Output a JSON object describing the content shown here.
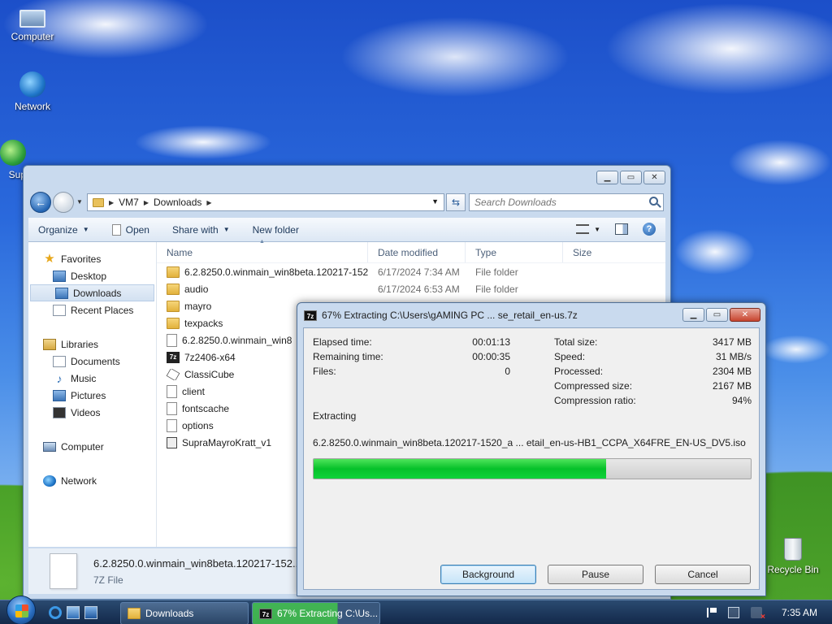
{
  "desktop": {
    "icons": [
      {
        "label": "Computer",
        "icon": "computer-icon"
      },
      {
        "label": "Network",
        "icon": "network-icon"
      },
      {
        "label": "Sup",
        "icon": "support-icon"
      },
      {
        "label": "Recycle Bin",
        "icon": "recycle-bin-icon"
      }
    ]
  },
  "explorer": {
    "breadcrumb": [
      "VM7",
      "Downloads"
    ],
    "search_placeholder": "Search Downloads",
    "toolbar": {
      "organize": "Organize",
      "open": "Open",
      "share_with": "Share with",
      "new_folder": "New folder"
    },
    "nav": {
      "favorites": "Favorites",
      "desktop": "Desktop",
      "downloads": "Downloads",
      "recent_places": "Recent Places",
      "libraries": "Libraries",
      "documents": "Documents",
      "music": "Music",
      "pictures": "Pictures",
      "videos": "Videos",
      "computer": "Computer",
      "network": "Network"
    },
    "columns": {
      "name": "Name",
      "date_modified": "Date modified",
      "type": "Type",
      "size": "Size"
    },
    "files": [
      {
        "name": "6.2.8250.0.winmain_win8beta.120217-152...",
        "date": "6/17/2024 7:34 AM",
        "type": "File folder",
        "icon": "folder-icon"
      },
      {
        "name": "audio",
        "date": "6/17/2024 6:53 AM",
        "type": "File folder",
        "icon": "folder-icon"
      },
      {
        "name": "mayro",
        "date": "",
        "type": "",
        "icon": "folder-icon"
      },
      {
        "name": "texpacks",
        "date": "",
        "type": "",
        "icon": "folder-icon"
      },
      {
        "name": "6.2.8250.0.winmain_win8",
        "date": "",
        "type": "",
        "icon": "file-icon"
      },
      {
        "name": "7z2406-x64",
        "date": "",
        "type": "",
        "icon": "7zip-icon"
      },
      {
        "name": "ClassiCube",
        "date": "",
        "type": "",
        "icon": "cube-icon"
      },
      {
        "name": "client",
        "date": "",
        "type": "",
        "icon": "file-icon"
      },
      {
        "name": "fontscache",
        "date": "",
        "type": "",
        "icon": "file-icon"
      },
      {
        "name": "options",
        "date": "",
        "type": "",
        "icon": "file-icon"
      },
      {
        "name": "SupraMayroKratt_v1",
        "date": "",
        "type": "",
        "icon": "exe-icon"
      }
    ],
    "details": {
      "name": "6.2.8250.0.winmain_win8beta.120217-152...",
      "type": "7Z File"
    }
  },
  "dialog": {
    "title": "67% Extracting C:\\Users\\gAMING PC ... se_retail_en-us.7z",
    "elapsed_label": "Elapsed time:",
    "elapsed_value": "00:01:13",
    "remaining_label": "Remaining time:",
    "remaining_value": "00:00:35",
    "files_label": "Files:",
    "files_value": "0",
    "total_size_label": "Total size:",
    "total_size_value": "3417 MB",
    "speed_label": "Speed:",
    "speed_value": "31 MB/s",
    "processed_label": "Processed:",
    "processed_value": "2304 MB",
    "compressed_label": "Compressed size:",
    "compressed_value": "2167 MB",
    "ratio_label": "Compression ratio:",
    "ratio_value": "94%",
    "status": "Extracting",
    "current_file": "6.2.8250.0.winmain_win8beta.120217-1520_a ... etail_en-us-HB1_CCPA_X64FRE_EN-US_DV5.iso",
    "progress_fraction": 0.67,
    "buttons": {
      "background": "Background",
      "pause": "Pause",
      "cancel": "Cancel"
    }
  },
  "taskbar": {
    "tasks": [
      {
        "label": "Downloads"
      },
      {
        "label": "67% Extracting C:\\Us..."
      }
    ],
    "clock": "7:35 AM"
  }
}
